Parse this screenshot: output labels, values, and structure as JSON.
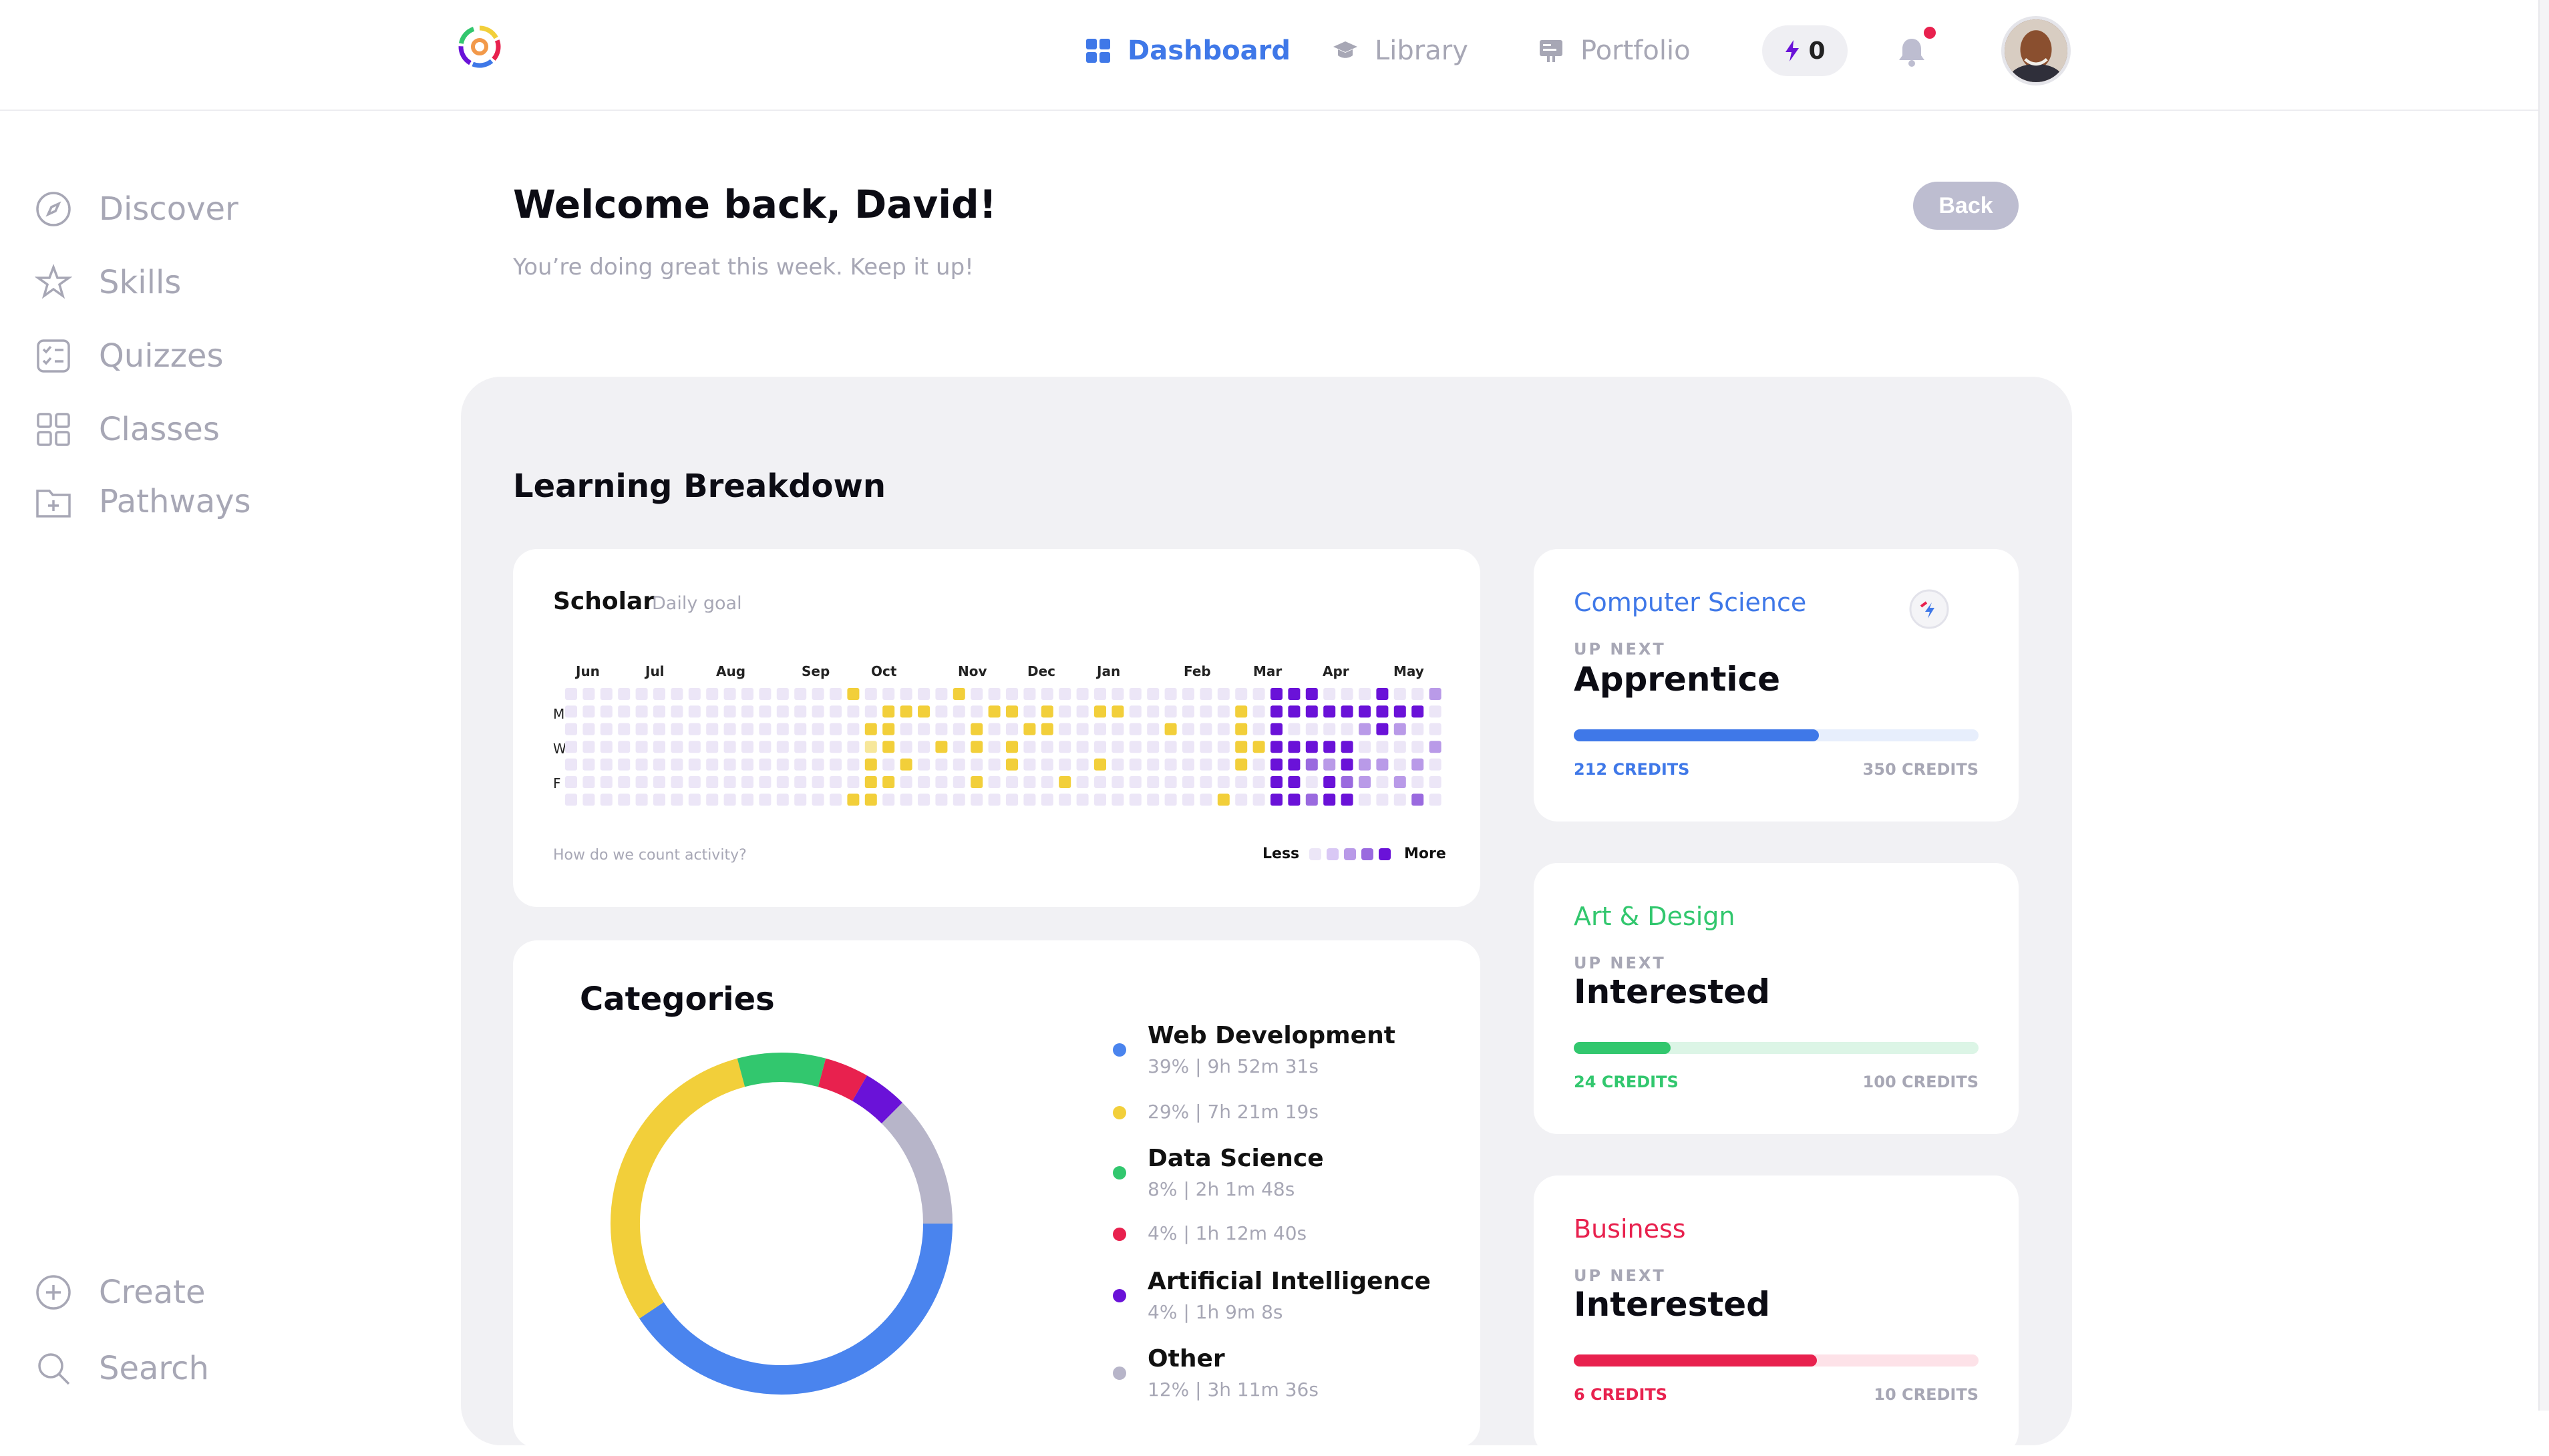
{
  "nav": {
    "items": [
      {
        "label": "Dashboard",
        "icon": "dashboard-icon",
        "active": true
      },
      {
        "label": "Library",
        "icon": "graduation-cap-icon",
        "active": false
      },
      {
        "label": "Portfolio",
        "icon": "portfolio-icon",
        "active": false
      }
    ],
    "credits": "0",
    "notification_dot_color": "#e8214e"
  },
  "sidebar": {
    "items": [
      {
        "label": "Discover",
        "icon": "compass-icon"
      },
      {
        "label": "Skills",
        "icon": "star-icon"
      },
      {
        "label": "Quizzes",
        "icon": "checklist-icon"
      },
      {
        "label": "Classes",
        "icon": "grid-icon"
      },
      {
        "label": "Pathways",
        "icon": "folder-plus-icon"
      }
    ],
    "bottom": [
      {
        "label": "Create",
        "icon": "plus-circle-icon"
      },
      {
        "label": "Search",
        "icon": "search-icon"
      }
    ]
  },
  "header": {
    "title": "Welcome back, David!",
    "subtitle": "You’re doing great this week. Keep it up!",
    "back_label": "Back"
  },
  "breakdown": {
    "title": "Learning Breakdown",
    "heatmap": {
      "title": "Scholar",
      "subtitle": "Daily goal",
      "months": [
        "Jun",
        "Jul",
        "Aug",
        "Sep",
        "Oct",
        "Nov",
        "Dec",
        "Jan",
        "Feb",
        "Mar",
        "Apr",
        "May"
      ],
      "day_labels": [
        "M",
        "W",
        "F"
      ],
      "link": "How do we count activity?",
      "less": "Less",
      "more": "More",
      "colors": {
        "empty": "#ece6f7",
        "yellow": "#f2cf3a",
        "yellow_light": "#f7e79a",
        "purple_1": "#d9c8f5",
        "purple_2": "#b99ae8",
        "purple_3": "#9a6adf",
        "purple_4": "#6a12d8"
      }
    },
    "categories": {
      "title": "Categories",
      "items": [
        {
          "name": "Web Development",
          "stat": "39% | 9h 52m 31s",
          "color": "#4a84ee",
          "percent": 39
        },
        {
          "name": "",
          "stat": "29% | 7h 21m 19s",
          "color": "#f2cf3a",
          "percent": 29
        },
        {
          "name": "Data Science",
          "stat": "8% | 2h 1m 48s",
          "color": "#32c76e",
          "percent": 8
        },
        {
          "name": "",
          "stat": "4% | 1h 12m 40s",
          "color": "#e8214e",
          "percent": 4
        },
        {
          "name": "Artificial Intelligence",
          "stat": "4% | 1h 9m 8s",
          "color": "#6a12d8",
          "percent": 4
        },
        {
          "name": "Other",
          "stat": "12% | 3h 11m 36s",
          "color": "#b7b5c9",
          "percent": 12
        }
      ]
    }
  },
  "skills": [
    {
      "name": "Computer Science",
      "upnext": "UP NEXT",
      "level": "Apprentice",
      "credits": "212 CREDITS",
      "target": "350 CREDITS",
      "progress": 0.606,
      "color": "#3f78e8",
      "track": "#e7eefc"
    },
    {
      "name": "Art & Design",
      "upnext": "UP NEXT",
      "level": "Interested",
      "credits": "24 CREDITS",
      "target": "100 CREDITS",
      "progress": 0.24,
      "color": "#32c76e",
      "track": "#dcf5e6"
    },
    {
      "name": "Business",
      "upnext": "UP NEXT",
      "level": "Interested",
      "credits": "6 CREDITS",
      "target": "10 CREDITS",
      "progress": 0.6,
      "color": "#e8214e",
      "track": "#fde2e8"
    }
  ]
}
